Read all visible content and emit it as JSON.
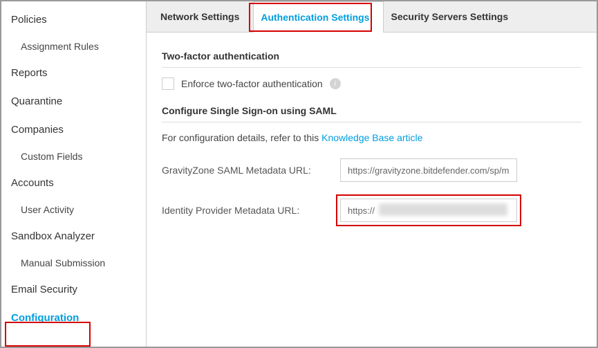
{
  "sidebar": {
    "items": [
      {
        "label": "Policies",
        "sub": [
          {
            "label": "Assignment Rules"
          }
        ]
      },
      {
        "label": "Reports"
      },
      {
        "label": "Quarantine"
      },
      {
        "label": "Companies",
        "sub": [
          {
            "label": "Custom Fields"
          }
        ]
      },
      {
        "label": "Accounts",
        "sub": [
          {
            "label": "User Activity"
          }
        ]
      },
      {
        "label": "Sandbox Analyzer",
        "sub": [
          {
            "label": "Manual Submission"
          }
        ]
      },
      {
        "label": "Email Security"
      },
      {
        "label": "Configuration",
        "active": true
      }
    ]
  },
  "tabs": [
    {
      "label": "Network Settings"
    },
    {
      "label": "Authentication Settings",
      "active": true
    },
    {
      "label": "Security Servers Settings"
    }
  ],
  "twofa": {
    "title": "Two-factor authentication",
    "checkbox_label": "Enforce two-factor authentication"
  },
  "sso": {
    "title": "Configure Single Sign-on using SAML",
    "desc_prefix": "For configuration details, refer to this ",
    "link_text": "Knowledge Base article",
    "gz_label": "GravityZone SAML Metadata URL:",
    "gz_value": "https://gravityzone.bitdefender.com/sp/m",
    "idp_label": "Identity Provider Metadata URL:",
    "idp_value": "https://"
  }
}
